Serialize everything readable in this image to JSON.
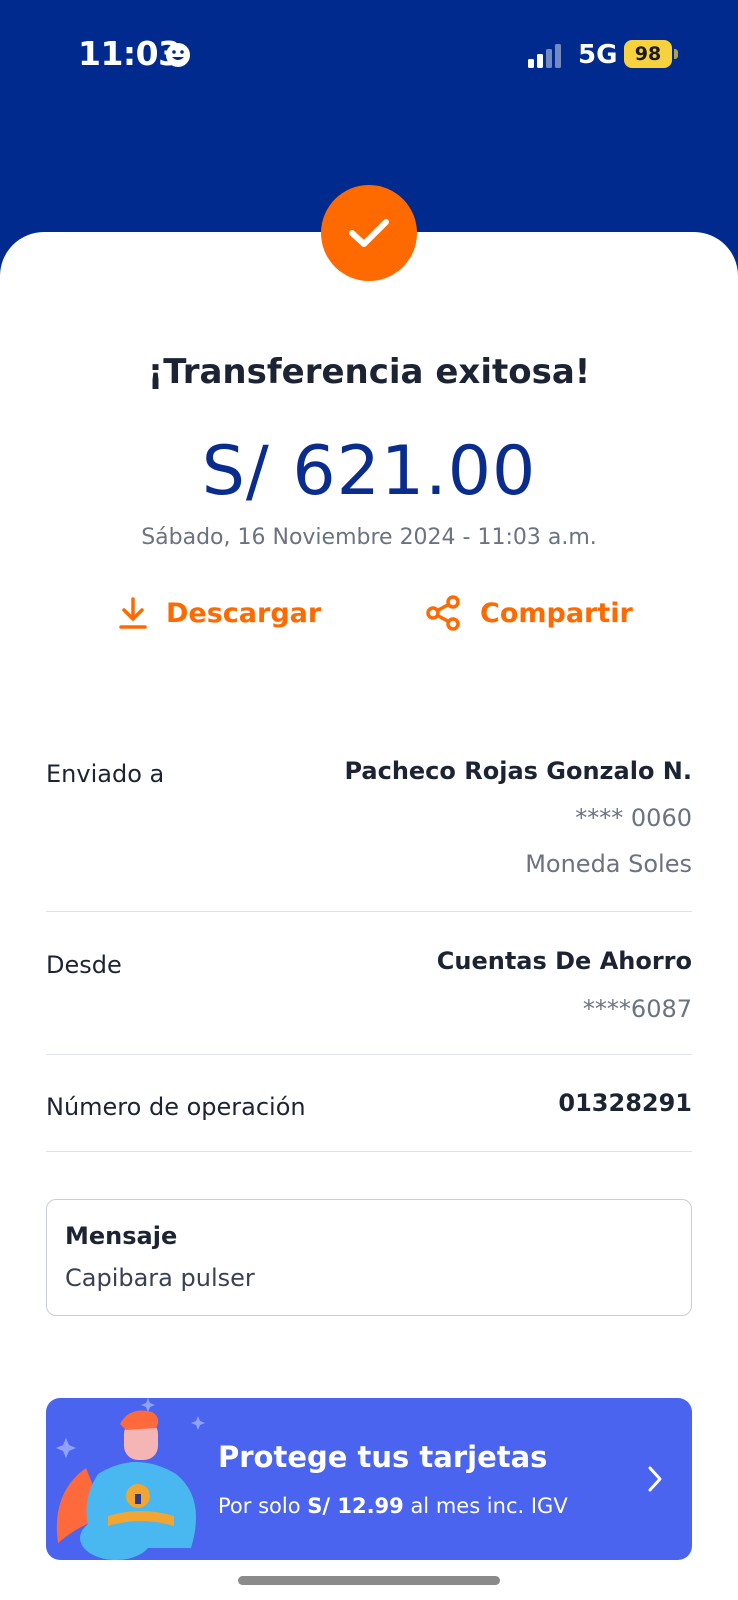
{
  "status_bar": {
    "time": "11:03",
    "network": "5G",
    "battery": "98"
  },
  "receipt": {
    "title": "¡Transferencia exitosa!",
    "amount": "S/ 621.00",
    "datetime": "Sábado, 16 Noviembre 2024 - 11:03 a.m.",
    "actions": {
      "download_label": "Descargar",
      "share_label": "Compartir"
    },
    "details": {
      "sent_to": {
        "label": "Enviado a",
        "name": "Pacheco Rojas Gonzalo N.",
        "account": "**** 0060",
        "currency": "Moneda Soles"
      },
      "from": {
        "label": "Desde",
        "account_type": "Cuentas De Ahorro",
        "account": "****6087"
      },
      "operation": {
        "label": "Número de operación",
        "number": "01328291"
      }
    },
    "message": {
      "title": "Mensaje",
      "text": "Capibara pulser"
    }
  },
  "promo": {
    "title": "Protege tus tarjetas",
    "sub_prefix": "Por solo ",
    "sub_price": "S/ 12.99",
    "sub_suffix": " al mes inc. IGV"
  },
  "colors": {
    "header_bg": "#002a8d",
    "accent_orange": "#ff6a00",
    "amount_blue": "#0a2c8c",
    "promo_bg": "#4b64ef",
    "battery_yellow": "#f7d23e"
  },
  "icons": [
    "smiley-face-icon",
    "cellular-signal-icon",
    "checkmark-icon",
    "download-icon",
    "share-icon",
    "superhero-illustration",
    "chevron-right-icon"
  ]
}
